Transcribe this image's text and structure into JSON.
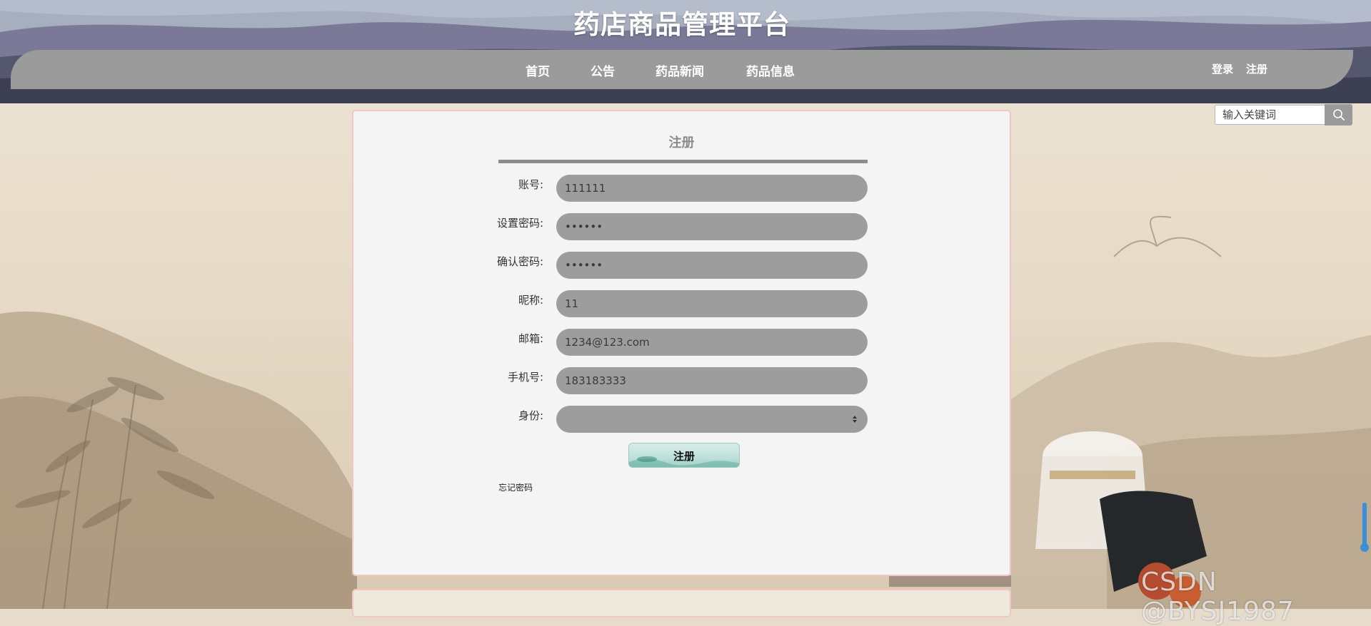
{
  "header": {
    "site_title": "药店商品管理平台",
    "nav": [
      "首页",
      "公告",
      "药品新闻",
      "药品信息"
    ],
    "login_label": "登录",
    "register_label": "注册"
  },
  "search": {
    "placeholder": "输入关键词",
    "icon": "search-icon"
  },
  "form": {
    "title": "注册",
    "fields": [
      {
        "label": "账号:",
        "value": "111111",
        "type": "text"
      },
      {
        "label": "设置密码:",
        "value": "••••••",
        "type": "password"
      },
      {
        "label": "确认密码:",
        "value": "••••••",
        "type": "password"
      },
      {
        "label": "昵称:",
        "value": "11",
        "type": "text"
      },
      {
        "label": "邮箱:",
        "value": "1234@123.com",
        "type": "text"
      },
      {
        "label": "手机号:",
        "value": "183183333",
        "type": "text"
      },
      {
        "label": "身份:",
        "value": "",
        "type": "select"
      }
    ],
    "submit_label": "注册",
    "forgot_label": "忘记密码"
  },
  "watermark": "CSDN @BYSJ1987",
  "colors": {
    "nav_bg": "#9b9b9b",
    "field_bg": "#9d9d9d",
    "panel_bg": "#f4f4f4",
    "panel_border": "#f4c5c5",
    "scrollbar": "#3a8fd6"
  }
}
